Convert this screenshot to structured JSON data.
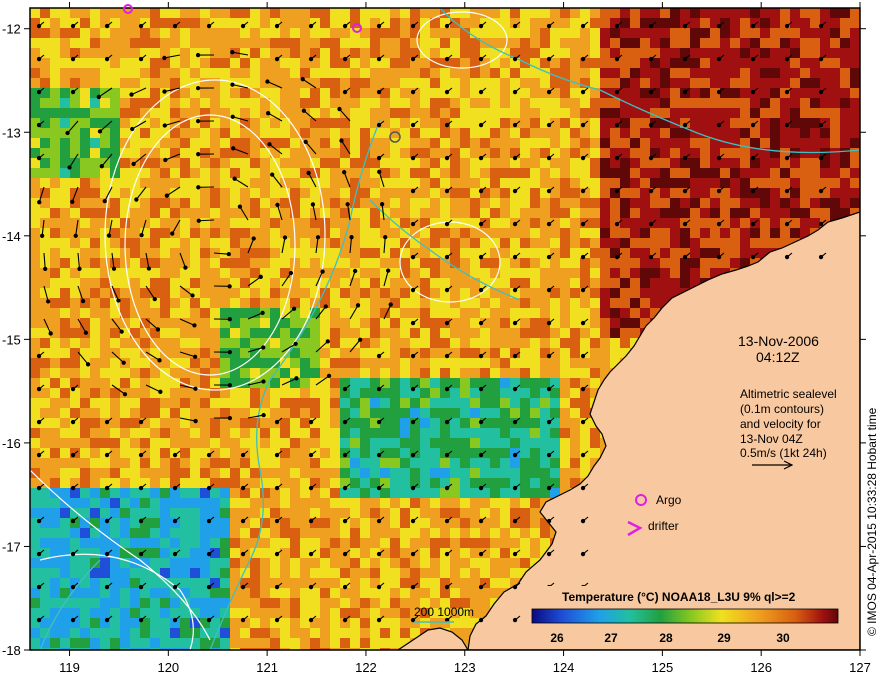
{
  "map": {
    "lon_range": [
      118.6,
      127.0
    ],
    "lat_range": [
      -18.0,
      -11.8
    ],
    "lon_ticks": [
      119,
      120,
      121,
      122,
      123,
      124,
      125,
      126,
      127
    ],
    "lat_ticks": [
      -12,
      -13,
      -14,
      -15,
      -16,
      -17,
      -18
    ],
    "lon_tick_labels": [
      "119",
      "120",
      "121",
      "122",
      "123",
      "124",
      "125",
      "126",
      "127"
    ],
    "lat_tick_labels": [
      "-12",
      "-13",
      "-14",
      "-15",
      "-16",
      "-17",
      "-18"
    ]
  },
  "annotation": {
    "date": "13-Nov-2006",
    "time": "04:12Z",
    "desc_lines": [
      "Altimetric sealevel",
      "(0.1m contours)",
      "and velocity for",
      "13-Nov 04Z",
      "0.5m/s (1kt 24h)"
    ]
  },
  "legend": {
    "argo_label": "Argo",
    "drifter_label": "drifter",
    "depth_label": "200  1000m",
    "colorbar_title": "Temperature (°C) NOAA18_L3U 9% ql>=2",
    "colorbar_ticks": [
      "26",
      "27",
      "28",
      "29",
      "30"
    ]
  },
  "credit": "© IMOS 04-Apr-2015 10:33:28 Hobart time",
  "colors": {
    "land": "#f8c9a0",
    "coastline": "#000000",
    "contour": "#ffffff",
    "isobath": "#3fbfbf",
    "argo": "#e020e0",
    "drifter": "#e020e0",
    "sst_scale": [
      "#0a0a80",
      "#1f4fd8",
      "#1fa0e8",
      "#22c0a0",
      "#22a040",
      "#88c820",
      "#f0e020",
      "#f0a020",
      "#d86010",
      "#a01010",
      "#600808"
    ]
  }
}
